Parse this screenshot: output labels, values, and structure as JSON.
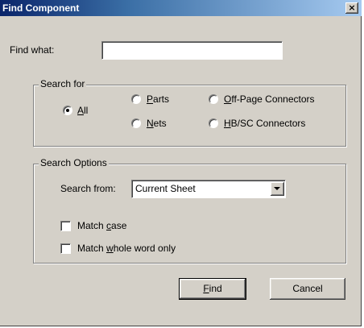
{
  "window": {
    "title": "Find Component",
    "close_glyph": "×"
  },
  "find_what": {
    "label": "Find what:",
    "value": ""
  },
  "search_for": {
    "title": "Search for",
    "options": [
      {
        "label": "All",
        "mnemonic": "A",
        "selected": true
      },
      {
        "label": "Parts",
        "mnemonic": "P",
        "selected": false
      },
      {
        "label": "Nets",
        "mnemonic": "N",
        "selected": false
      },
      {
        "label": "Off-Page Connectors",
        "mnemonic": "O",
        "selected": false
      },
      {
        "label": "HB/SC Connectors",
        "mnemonic": "H",
        "selected": false
      }
    ]
  },
  "search_options": {
    "title": "Search Options",
    "search_from_label": "Search from:",
    "search_from_value": "Current Sheet",
    "match_case": {
      "label": "Match case",
      "checked": false
    },
    "match_whole_word": {
      "label": "Match whole word only",
      "checked": false
    }
  },
  "buttons": {
    "find": "Find",
    "cancel": "Cancel"
  },
  "colors": {
    "dialog_bg": "#d4d0c8",
    "titlebar": "#0a246a"
  }
}
